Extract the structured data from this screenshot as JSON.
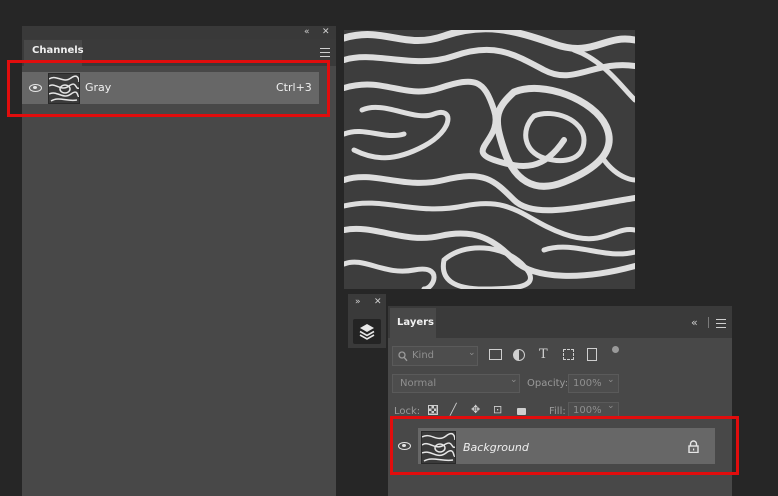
{
  "channels_panel": {
    "collapse_glyph": "«",
    "close_glyph": "✕",
    "tab_label": "Channels",
    "menu_icon": "hamburger-menu-icon",
    "rows": [
      {
        "name": "Gray",
        "shortcut": "Ctrl+3",
        "visible": true
      }
    ]
  },
  "mini_dock": {
    "expand_glyph": "»",
    "close_glyph": "✕",
    "button_icon": "layers-icon"
  },
  "layers_panel": {
    "tab_label": "Layers",
    "collapse_glyph": "«",
    "menu_icon": "hamburger-menu-icon",
    "filter_kind": "Kind",
    "blend_mode": "Normal",
    "opacity_label": "Opacity:",
    "opacity_value": "100%",
    "lock_label": "Lock:",
    "fill_label": "Fill:",
    "fill_value": "100%",
    "filter_icons": [
      "image-filter-icon",
      "adjustment-filter-icon",
      "type-filter-icon",
      "shape-filter-icon",
      "smart-object-filter-icon",
      "filter-toggle-icon"
    ],
    "lock_icons": [
      "lock-pixels-icon",
      "lock-brush-icon",
      "lock-position-icon",
      "lock-artboard-icon",
      "lock-all-icon"
    ],
    "layers": [
      {
        "name": "Background",
        "visible": true,
        "locked": true
      }
    ]
  },
  "colors": {
    "highlight": "#e10d0d",
    "panel_bg": "#484848",
    "selected_row": "#676767",
    "app_bg": "#262626"
  }
}
